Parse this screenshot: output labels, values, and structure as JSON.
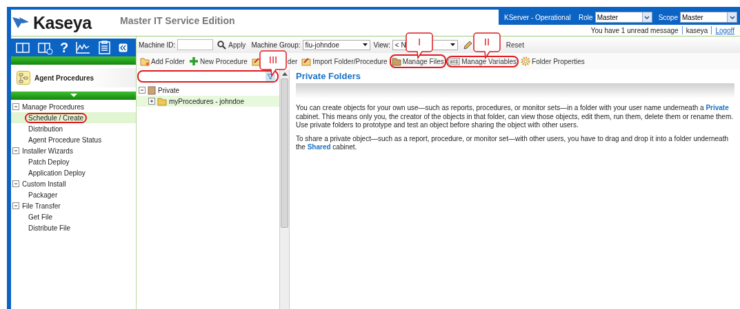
{
  "header": {
    "logo": "Kaseya",
    "edition": "Master IT Service Edition",
    "status": "KServer - Operational",
    "role": {
      "label": "Role",
      "value": "Master"
    },
    "scope": {
      "label": "Scope",
      "value": "Master"
    },
    "message": "You have 1 unread message",
    "user": "kaseya",
    "logoff": "Logoff"
  },
  "nav_icons": [
    {
      "kind": "book"
    },
    {
      "kind": "book-plus"
    },
    {
      "kind": "help",
      "glyph": "?"
    },
    {
      "kind": "chart"
    },
    {
      "kind": "clipboard"
    },
    {
      "kind": "collapse"
    }
  ],
  "module": {
    "title": "Agent Procedures"
  },
  "nav_tree": [
    {
      "label": "Manage Procedures",
      "expanded": true,
      "children": [
        {
          "label": "Schedule / Create",
          "selected": true,
          "circled": true
        },
        {
          "label": "Distribution",
          "selected": false,
          "circled": false
        },
        {
          "label": "Agent Procedure Status",
          "selected": false,
          "circled": false
        }
      ]
    },
    {
      "label": "Installer Wizards",
      "expanded": true,
      "children": [
        {
          "label": "Patch Deploy",
          "selected": false,
          "circled": false
        },
        {
          "label": "Application Deploy",
          "selected": false,
          "circled": false
        }
      ]
    },
    {
      "label": "Custom Install",
      "expanded": true,
      "children": [
        {
          "label": "Packager",
          "selected": false,
          "circled": false
        }
      ]
    },
    {
      "label": "File Transfer",
      "expanded": true,
      "children": [
        {
          "label": "Get File",
          "selected": false,
          "circled": false
        },
        {
          "label": "Distribute File",
          "selected": false,
          "circled": false
        }
      ]
    }
  ],
  "filter_bar": {
    "machine_id_label": "Machine ID:",
    "apply": "Apply",
    "group_label": "Machine Group:",
    "group_value": "fiu-johndoe",
    "view_label": "View:",
    "view_value": "< N",
    "reset": "Reset"
  },
  "actions": [
    {
      "kind": "add-folder",
      "label": "Add Folder",
      "circled": false
    },
    {
      "kind": "new",
      "label": "New Procedure",
      "circled": false
    },
    {
      "kind": "export",
      "label": "der",
      "circled": false
    },
    {
      "kind": "import",
      "label": "Import Folder/Procedure",
      "circled": false
    },
    {
      "kind": "files",
      "label": "Manage Files",
      "circled": true
    },
    {
      "kind": "variables",
      "label": "Manage Variables",
      "badge": "x=1",
      "circled": true
    },
    {
      "kind": "properties",
      "label": "Folder Properties",
      "circled": false
    }
  ],
  "tree_filter": {
    "circled": true
  },
  "folder_tree": [
    {
      "label": "Private",
      "expanded": true,
      "children": [
        {
          "label": "myProcedures - johndoe",
          "expanded": false,
          "selected": true
        }
      ]
    }
  ],
  "content": {
    "title": "Private Folders",
    "paragraphs": [
      "You can create objects for your own use—such as reports, procedures, or monitor sets—in a folder with your user name underneath a **Private** cabinet. This means only you, the creator of the objects in that folder, can view those objects, edit them, run them, delete them or rename them. Use private folders to prototype and test an object before sharing the object with other users.",
      "To share a private object—such as a report, procedure, or monitor set—with other users, you have to drag and drop it into a folder underneath the **Shared** cabinet."
    ]
  },
  "callouts": [
    {
      "label": "I"
    },
    {
      "label": "II"
    },
    {
      "label": "III"
    }
  ]
}
